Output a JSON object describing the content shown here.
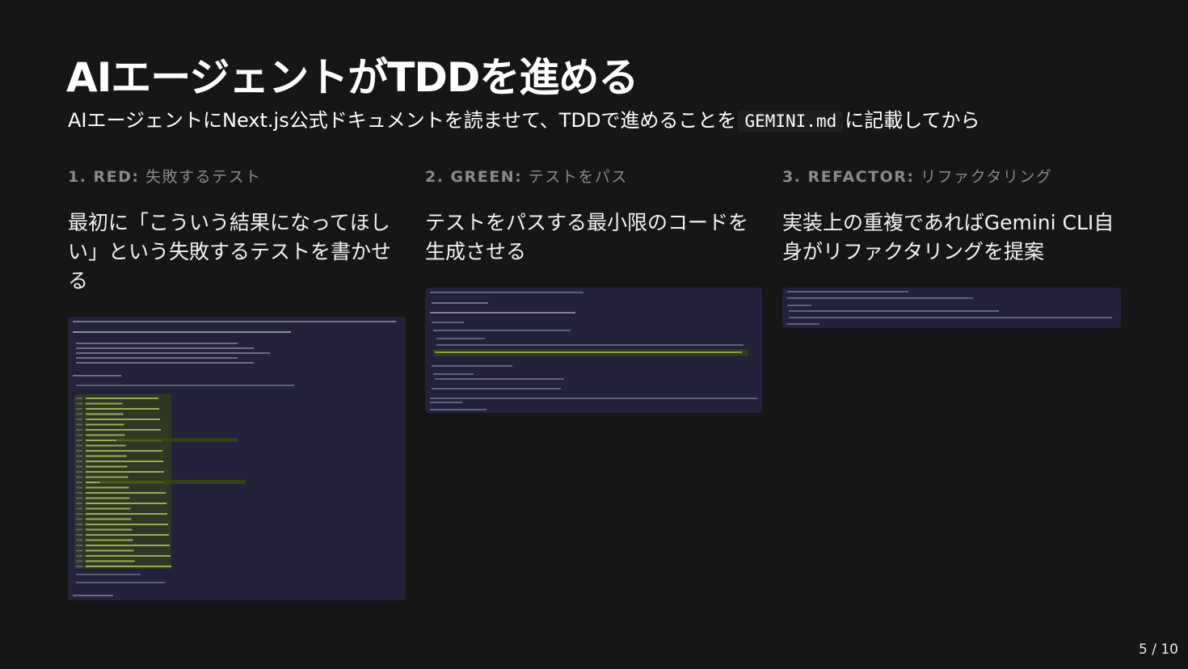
{
  "slide": {
    "title": "AIエージェントがTDDを進める",
    "subtitle_before": "AIエージェントにNext.js公式ドキュメントを読ませて、TDDで進めることを",
    "subtitle_code": "GEMINI.md",
    "subtitle_after": "に記載してから",
    "page_number": "5 / 10"
  },
  "steps": [
    {
      "name": "1. RED:",
      "label": "失敗するテスト",
      "description": "最初に「こういう結果になってほしい」という失敗するテストを書かせる",
      "screenshot_icon": "terminal-screenshot"
    },
    {
      "name": "2. GREEN:",
      "label": "テストをパス",
      "description": "テストをパスする最小限のコードを生成させる",
      "screenshot_icon": "terminal-screenshot"
    },
    {
      "name": "3. REFACTOR:",
      "label": "リファクタリング",
      "description": "実装上の重複であればGemini CLI自身がリファクタリングを提案",
      "screenshot_icon": "terminal-screenshot"
    }
  ],
  "colors": {
    "background": "#161616",
    "label_gray": "#8a8a8a",
    "terminal_bg": "#23223a",
    "terminal_highlight": "#3a4a12"
  }
}
